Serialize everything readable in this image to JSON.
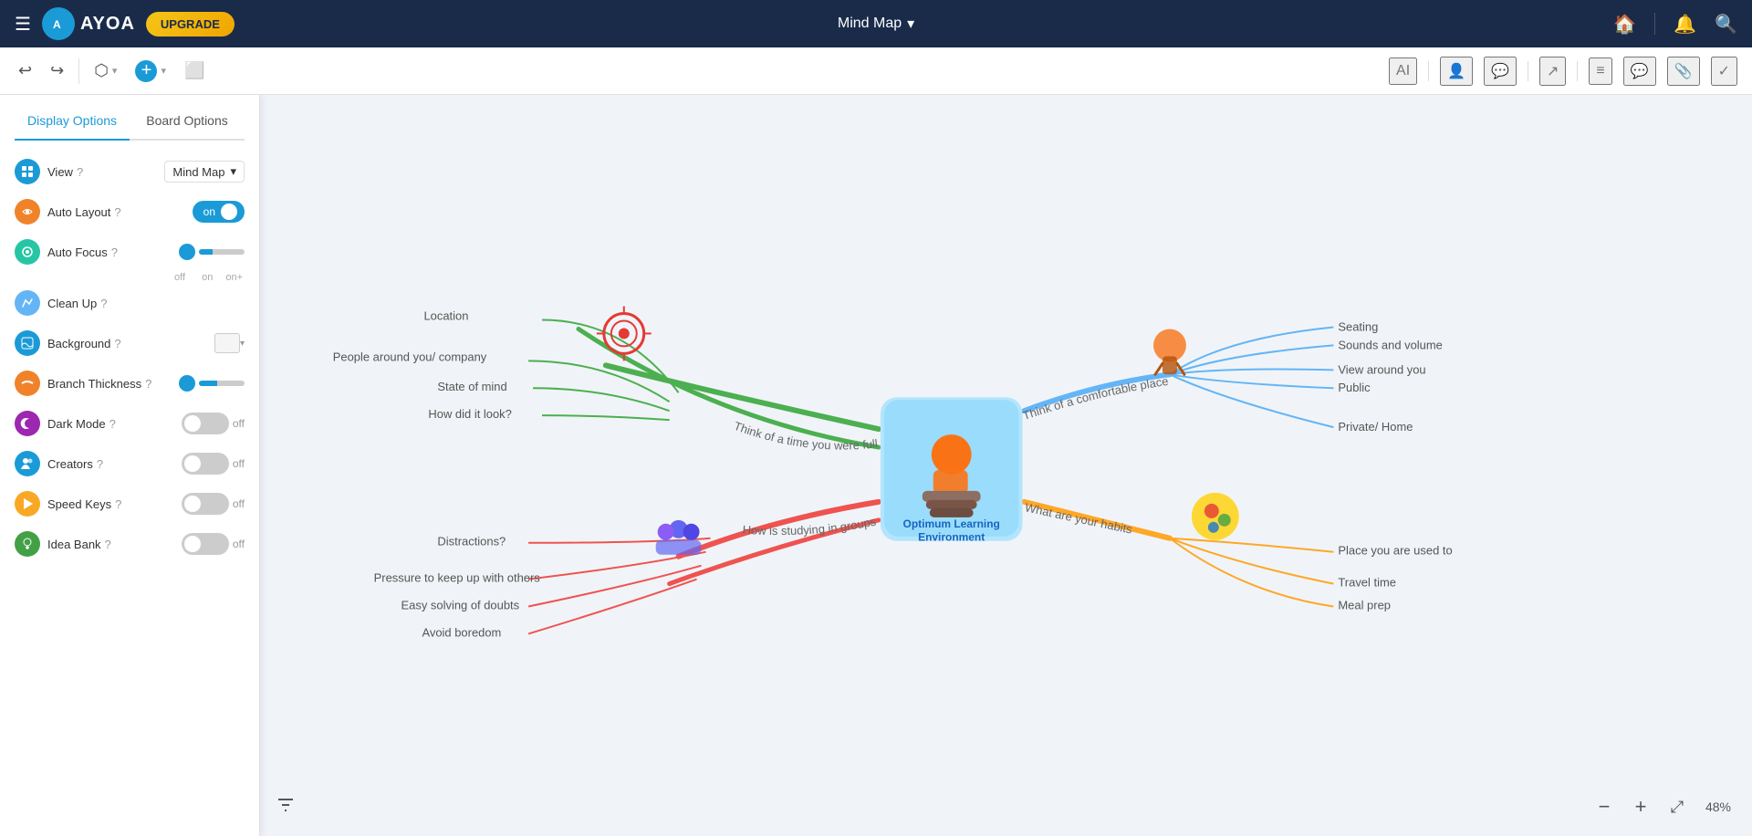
{
  "topNav": {
    "hamburger": "☰",
    "logoText": "AYOA",
    "upgradeLabel": "UPGRADE",
    "title": "Mind Map",
    "titleDropdown": "▾",
    "icons": {
      "home": "🏠",
      "bell": "🔔",
      "search": "🔍"
    }
  },
  "toolbar": {
    "undo": "↩",
    "redo": "↪",
    "shape": "⬡",
    "add": "+",
    "frame": "⬜",
    "rightIcons": [
      "AI",
      "👤+",
      "💬",
      "↗",
      "≡",
      "💬",
      "📎",
      "✓"
    ]
  },
  "sidePanel": {
    "tabs": {
      "display": "Display Options",
      "board": "Board Options"
    },
    "activeTab": "display",
    "rows": [
      {
        "id": "view",
        "label": "View",
        "hasHelp": true,
        "control": "dropdown",
        "value": "Mind Map"
      },
      {
        "id": "autoLayout",
        "label": "Auto Layout",
        "hasHelp": true,
        "control": "toggle-on",
        "value": "on"
      },
      {
        "id": "autoFocus",
        "label": "Auto Focus",
        "hasHelp": true,
        "control": "slider3",
        "values": [
          "off",
          "on",
          "on+"
        ]
      },
      {
        "id": "cleanUp",
        "label": "Clean Up",
        "hasHelp": true,
        "control": "none"
      },
      {
        "id": "background",
        "label": "Background",
        "hasHelp": true,
        "control": "color"
      },
      {
        "id": "branchThickness",
        "label": "Branch Thickness",
        "hasHelp": true,
        "control": "slider"
      },
      {
        "id": "darkMode",
        "label": "Dark Mode",
        "hasHelp": true,
        "control": "toggle-off",
        "value": "off"
      },
      {
        "id": "creators",
        "label": "Creators",
        "hasHelp": true,
        "control": "toggle-off",
        "value": "off"
      },
      {
        "id": "speedKeys",
        "label": "Speed Keys",
        "hasHelp": true,
        "control": "toggle-off",
        "value": "off"
      },
      {
        "id": "ideaBank",
        "label": "Idea Bank",
        "hasHelp": true,
        "control": "toggle-off",
        "value": "off"
      }
    ]
  },
  "mindMap": {
    "centralTitle": "Optimum Learning Environment",
    "branches": [
      {
        "id": "b1",
        "label": "Think of a time you were fully focused",
        "color": "#4caf50",
        "direction": "left-up",
        "children": [
          "Location",
          "People around you/ company",
          "State of mind",
          "How did it look?"
        ]
      },
      {
        "id": "b2",
        "label": "Think of a comfortable place",
        "color": "#64b5f6",
        "direction": "right-up",
        "children": [
          "Seating",
          "Sounds and volume",
          "View around you",
          "Public",
          "Private/ Home"
        ]
      },
      {
        "id": "b3",
        "label": "How is studying in groups for you?",
        "color": "#ef5350",
        "direction": "left-down",
        "children": [
          "Distractions?",
          "Pressure to keep up with others",
          "Easy solving of doubts",
          "Avoid boredom"
        ]
      },
      {
        "id": "b4",
        "label": "What are your habits",
        "color": "#ffa726",
        "direction": "right-down",
        "children": [
          "Place you are used to",
          "Travel time",
          "Meal prep"
        ]
      }
    ]
  },
  "bottomBar": {
    "filterIcon": "⚡",
    "zoom": {
      "minus": "−",
      "plus": "+",
      "expand": "⤢",
      "level": "48%"
    }
  }
}
